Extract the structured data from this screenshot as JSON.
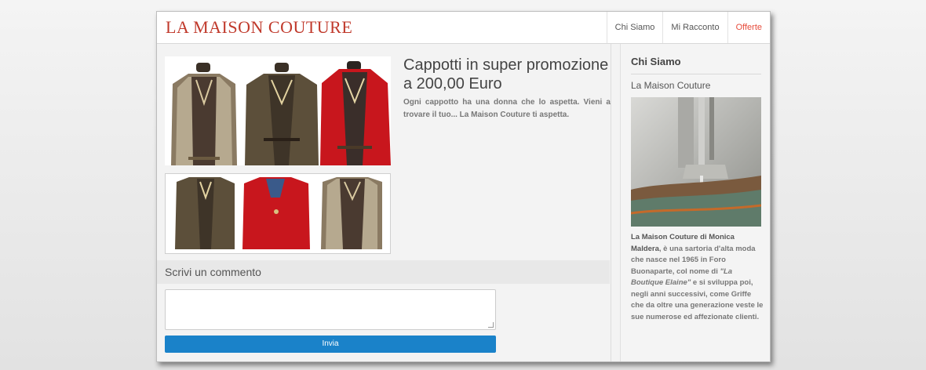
{
  "site": {
    "logo": "LA MAISON COUTURE"
  },
  "nav": {
    "items": [
      {
        "label": "Chi Siamo"
      },
      {
        "label": "Mi Racconto"
      },
      {
        "label": "Offerte"
      }
    ]
  },
  "article": {
    "title": "Cappotti in super promozione a 200,00 Euro",
    "text": "Ogni cappotto ha una donna che lo aspetta. Vieni a trovare il tuo... La Maison Couture ti aspetta."
  },
  "comments": {
    "title": "Scrivi un commento",
    "submit_label": "Invia"
  },
  "sidebar": {
    "heading": "Chi Siamo",
    "subheading": "La Maison Couture",
    "text_strong": "La Maison Couture di Monica Maldera",
    "text_1": ", è una sartoria d'alta moda che nasce nel 1965 in Foro Buonaparte, col nome di ",
    "text_em": "\"La Boutique Elaine\"",
    "text_2": " e si sviluppa poi, negli anni successivi, come Griffe che da oltre una generazione veste le sue numerose ed affezionate clienti."
  },
  "colors": {
    "brand": "#c0392b",
    "nav_active": "#e74c3c",
    "button": "#1a82c9"
  }
}
